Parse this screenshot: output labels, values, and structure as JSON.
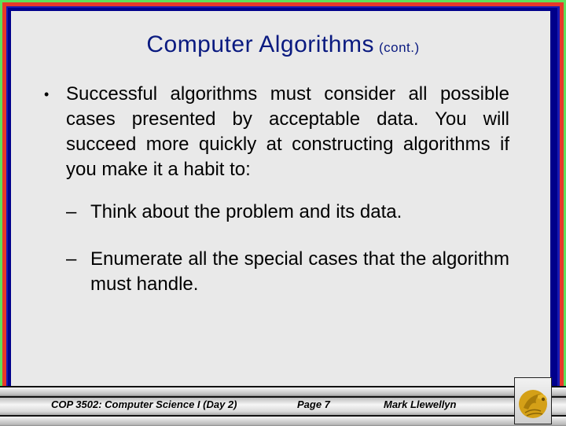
{
  "slide": {
    "title": "Computer Algorithms",
    "title_suffix": "(cont.)",
    "bullet": {
      "marker": "•",
      "text": "Successful algorithms must consider all possible cases presented by acceptable data. You will succeed more quickly at constructing algorithms if you make it a habit to:"
    },
    "sub_bullets": [
      {
        "marker": "–",
        "text": "Think about the problem and its data."
      },
      {
        "marker": "–",
        "text": "Enumerate all the special cases that the algorithm must handle."
      }
    ]
  },
  "footer": {
    "course": "COP 3502: Computer Science I  (Day 2)",
    "page": "Page 7",
    "author": "Mark Llewellyn",
    "logo_icon": "pegasus-logo-icon"
  },
  "colors": {
    "title": "#0a1a80",
    "border_outer": "#5fe05a",
    "border_red": "#e8392a",
    "border_blue": "#00008b",
    "background": "#e9e9e9",
    "logo_gold": "#d4a017"
  }
}
